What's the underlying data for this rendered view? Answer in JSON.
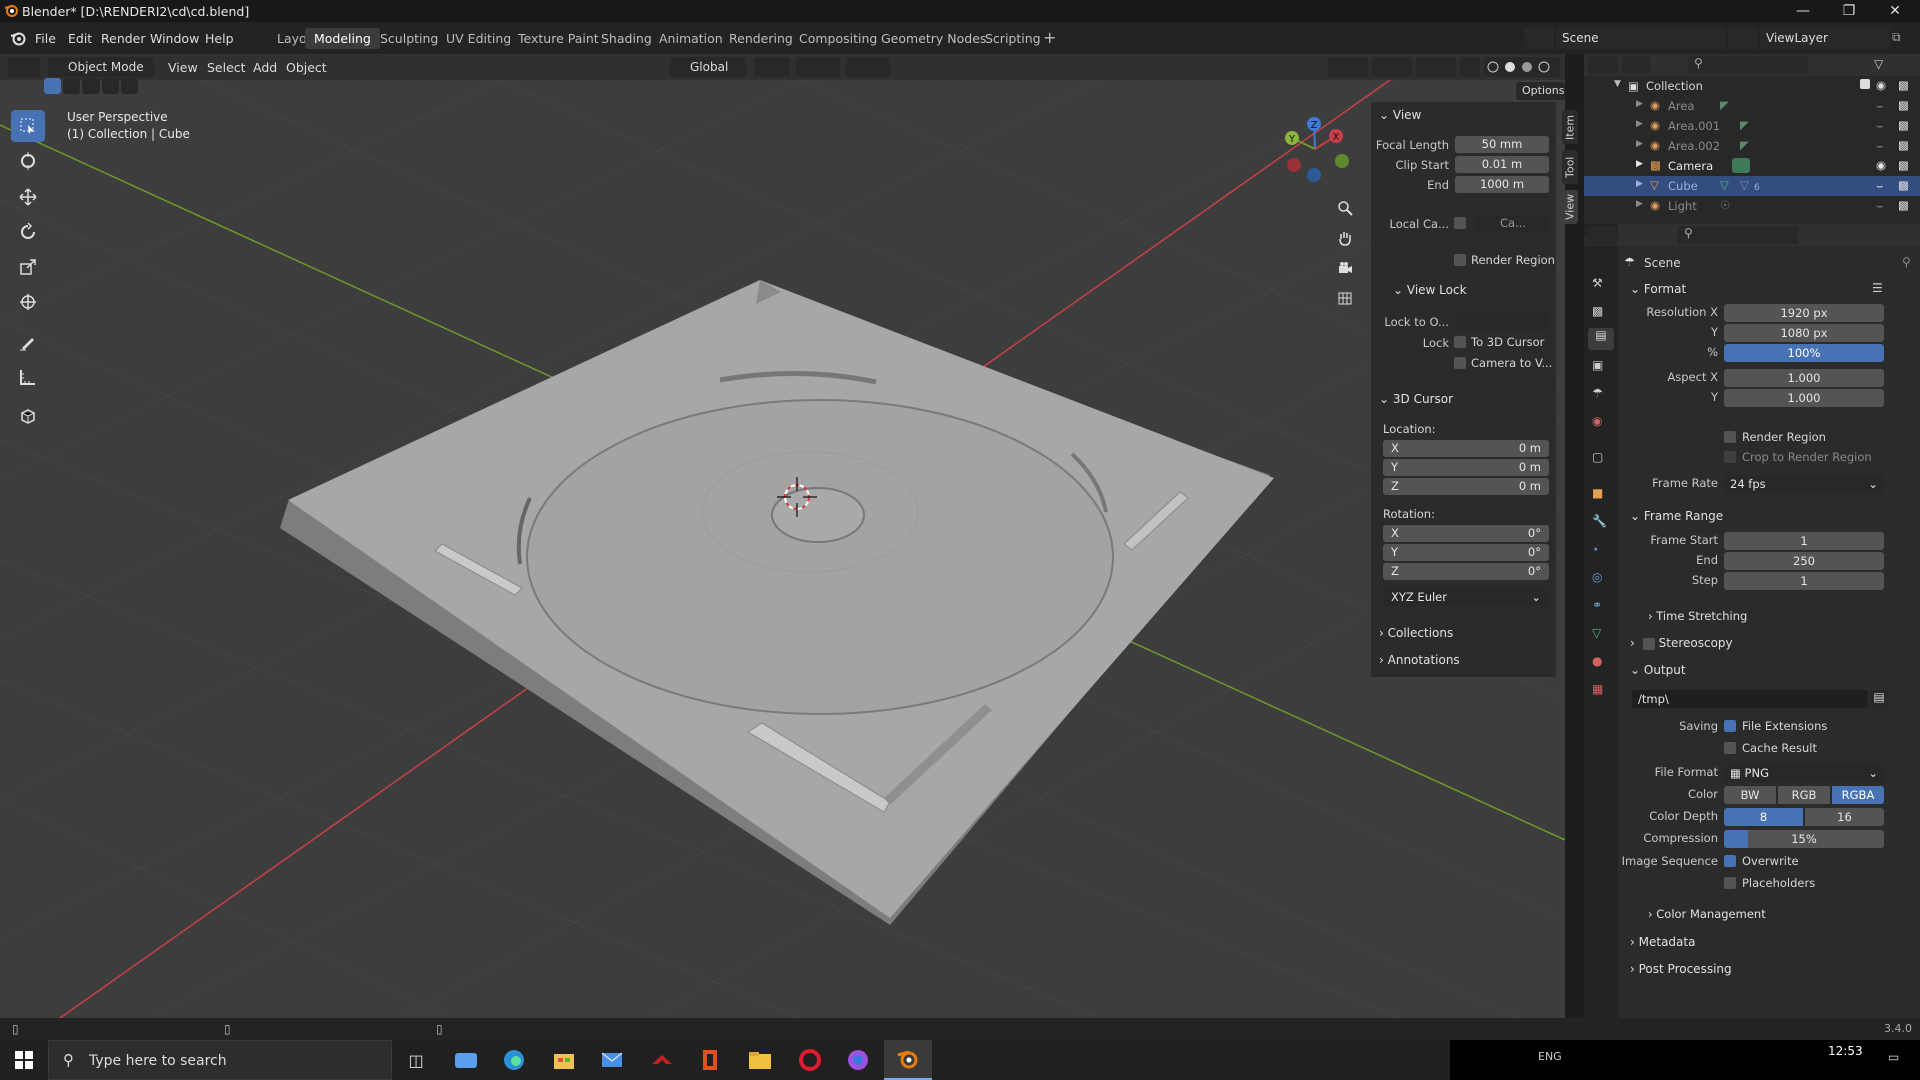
{
  "window": {
    "title": "Blender* [D:\\RENDERI2\\cd\\cd.blend]"
  },
  "menu": {
    "items": [
      "File",
      "Edit",
      "Render",
      "Window",
      "Help"
    ]
  },
  "workspaces": [
    "Layout",
    "Modeling",
    "Sculpting",
    "UV Editing",
    "Texture Paint",
    "Shading",
    "Animation",
    "Rendering",
    "Compositing",
    "Geometry Nodes",
    "Scripting"
  ],
  "workspace_active": "Modeling",
  "scene": {
    "name": "Scene",
    "view_layer": "ViewLayer"
  },
  "viewport_header": {
    "mode": "Object Mode",
    "menus": [
      "View",
      "Select",
      "Add",
      "Object"
    ],
    "orientation": "Global",
    "options": "Options"
  },
  "viewport": {
    "overlay_line1": "User Perspective",
    "overlay_line2": "(1) Collection | Cube",
    "gizmo": {
      "x": "X",
      "y": "Y",
      "z": "Z"
    }
  },
  "npanel": {
    "tabs": [
      "Item",
      "Tool",
      "View"
    ],
    "view_header": "View",
    "focal_length_label": "Focal Length",
    "focal_length": "50 mm",
    "clip_start_label": "Clip Start",
    "clip_start": "0.01 m",
    "clip_end_label": "End",
    "clip_end": "1000 m",
    "local_camera_label": "Local Ca...",
    "local_camera_value": "Ca...",
    "render_region_label": "Render Region",
    "view_lock_header": "View Lock",
    "lock_to_object_label": "Lock to O...",
    "lock_label": "Lock",
    "to_3d_cursor_label": "To 3D Cursor",
    "camera_to_view_label": "Camera to V...",
    "cursor_header": "3D Cursor",
    "location_label": "Location:",
    "loc_x_label": "X",
    "loc_x": "0 m",
    "loc_y_label": "Y",
    "loc_y": "0 m",
    "loc_z_label": "Z",
    "loc_z": "0 m",
    "rotation_label": "Rotation:",
    "rot_x_label": "X",
    "rot_x": "0°",
    "rot_y_label": "Y",
    "rot_y": "0°",
    "rot_z_label": "Z",
    "rot_z": "0°",
    "rotation_mode": "XYZ Euler",
    "collections_header": "Collections",
    "annotations_header": "Annotations"
  },
  "outliner": {
    "collection": "Collection",
    "items": [
      {
        "name": "Area",
        "selected": false,
        "visible": false
      },
      {
        "name": "Area.001",
        "selected": false,
        "visible": false
      },
      {
        "name": "Area.002",
        "selected": false,
        "visible": false
      },
      {
        "name": "Camera",
        "selected": false,
        "visible": true
      },
      {
        "name": "Cube",
        "selected": true,
        "visible": false,
        "modifier_count": "6"
      },
      {
        "name": "Light",
        "selected": false,
        "visible": false
      }
    ]
  },
  "properties": {
    "context": "Scene",
    "format_header": "Format",
    "res_x_label": "Resolution X",
    "res_x": "1920 px",
    "res_y_label": "Y",
    "res_y": "1080 px",
    "res_pct_label": "%",
    "res_pct": "100%",
    "aspect_x_label": "Aspect X",
    "aspect_x": "1.000",
    "aspect_y_label": "Y",
    "aspect_y": "1.000",
    "render_region_label": "Render Region",
    "crop_label": "Crop to Render Region",
    "frame_rate_label": "Frame Rate",
    "frame_rate": "24 fps",
    "frame_range_header": "Frame Range",
    "frame_start_label": "Frame Start",
    "frame_start": "1",
    "frame_end_label": "End",
    "frame_end": "250",
    "frame_step_label": "Step",
    "frame_step": "1",
    "time_stretching": "Time Stretching",
    "stereoscopy": "Stereoscopy",
    "output_header": "Output",
    "output_path": "/tmp\\",
    "saving_label": "Saving",
    "file_extensions_label": "File Extensions",
    "cache_result_label": "Cache Result",
    "file_format_label": "File Format",
    "file_format": "PNG",
    "color_label": "Color",
    "color_options": [
      "BW",
      "RGB",
      "RGBA"
    ],
    "color_active": "RGBA",
    "color_depth_label": "Color Depth",
    "color_depth_options": [
      "8",
      "16"
    ],
    "color_depth_active": "8",
    "compression_label": "Compression",
    "compression": "15%",
    "compression_fraction": 0.15,
    "image_sequence_label": "Image Sequence",
    "overwrite_label": "Overwrite",
    "placeholders_label": "Placeholders",
    "color_management": "Color Management",
    "metadata": "Metadata",
    "post_processing": "Post Processing"
  },
  "statusbar": {
    "version": "3.4.0"
  },
  "taskbar": {
    "search_placeholder": "Type here to search",
    "time": "12:53",
    "lang": "ENG"
  },
  "colors": {
    "accent": "#4772b3",
    "viewport_bg": "#3d3d3d",
    "panel_bg": "#2b2b2b",
    "x_axis": "#c8404a",
    "y_axis": "#6e9a2a",
    "z_axis": "#3c7bd6"
  }
}
